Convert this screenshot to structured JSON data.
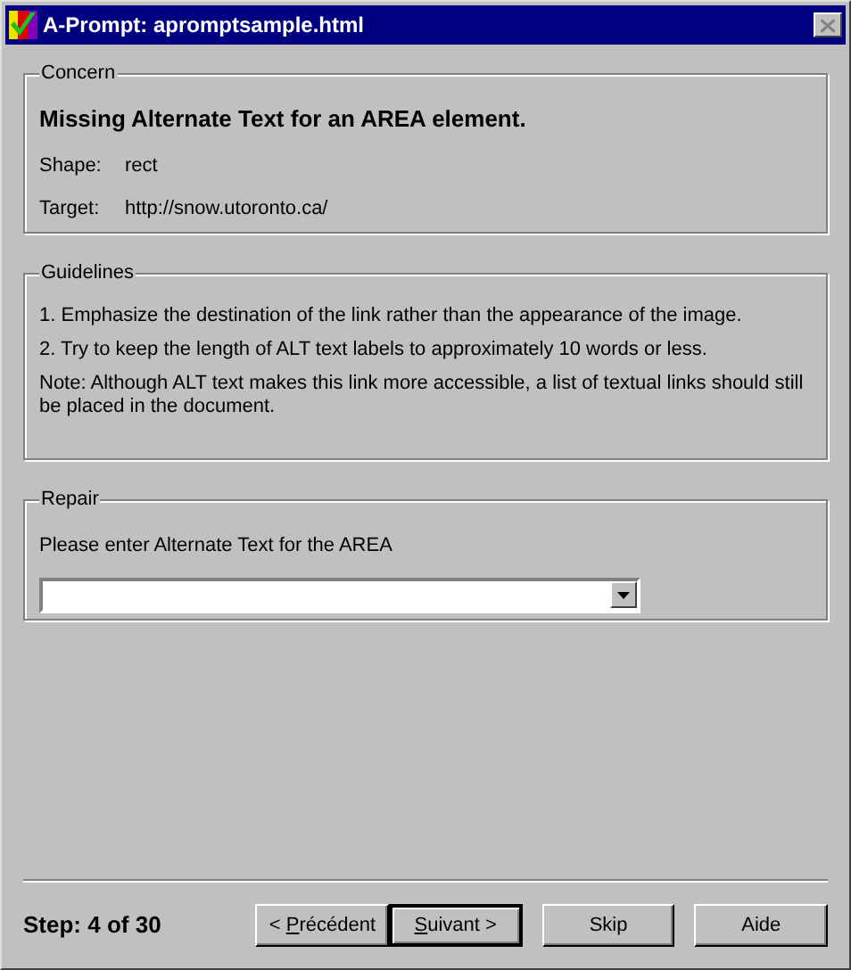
{
  "window": {
    "title": "A-Prompt: apromptsample.html"
  },
  "concern": {
    "legend": "Concern",
    "heading": "Missing Alternate Text for an AREA element.",
    "fields": [
      {
        "label": "Shape:",
        "value": "rect"
      },
      {
        "label": "Target:",
        "value": "http://snow.utoronto.ca/"
      }
    ]
  },
  "guidelines": {
    "legend": "Guidelines",
    "items": [
      "1. Emphasize the destination of the link rather than the appearance of the image.",
      "2. Try to keep the length of ALT text labels to approximately 10 words or less.",
      "Note: Although ALT text makes this link more accessible, a list of textual links should still be placed in the document."
    ]
  },
  "repair": {
    "legend": "Repair",
    "prompt": "Please enter Alternate Text for the AREA"
  },
  "step": "Step: 4 of 30",
  "buttons": [
    {
      "before": "< ",
      "key": "P",
      "after": "récédent",
      "default": false
    },
    {
      "key": "S",
      "after": "uivant >",
      "default": true
    },
    {
      "after": "Skip",
      "default": false
    },
    {
      "after": "Aide",
      "default": false
    }
  ]
}
